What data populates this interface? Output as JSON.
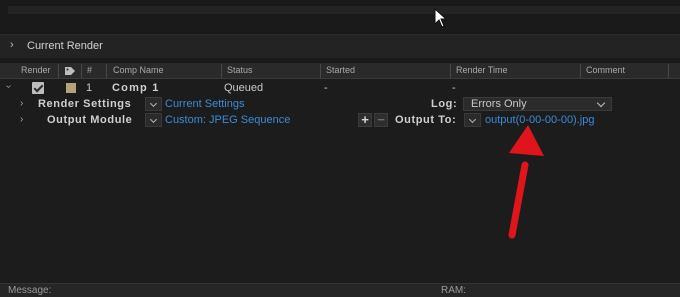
{
  "panel": {
    "section_title": "Current Render"
  },
  "columns": {
    "render": "Render",
    "number": "#",
    "comp_name": "Comp Name",
    "status": "Status",
    "started": "Started",
    "render_time": "Render Time",
    "comment": "Comment"
  },
  "queue_item": {
    "index": "1",
    "comp_name": "Comp 1",
    "status": "Queued",
    "started": "-",
    "render_time": "-",
    "label_color": "#b3a27a",
    "checked": true
  },
  "render_settings": {
    "label": "Render Settings",
    "value": "Current Settings",
    "log_label": "Log:",
    "log_value": "Errors Only"
  },
  "output_module": {
    "label": "Output Module",
    "value": "Custom: JPEG Sequence",
    "add_label": "+",
    "remove_label": "−",
    "output_to_label": "Output To:",
    "output_file": "output(0-00-00-00).jpg"
  },
  "footer": {
    "message_label": "Message:",
    "ram_label": "RAM:"
  },
  "colors": {
    "link": "#3c8bd8",
    "annotation_arrow": "#e0141b"
  }
}
